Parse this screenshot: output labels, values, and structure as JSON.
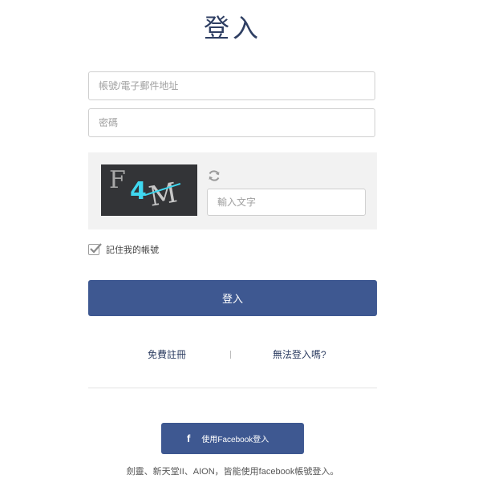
{
  "page": {
    "title": "登入"
  },
  "form": {
    "account_placeholder": "帳號/電子郵件地址",
    "password_placeholder": "密碼",
    "captcha": {
      "chars": [
        "F",
        "4",
        "M"
      ],
      "input_placeholder": "輸入文字",
      "refresh_icon": "refresh-icon"
    },
    "remember_label": "記住我的帳號",
    "remember_checked": true,
    "login_button": "登入"
  },
  "links": {
    "register": "免費註冊",
    "forgot": "無法登入嗎?"
  },
  "facebook": {
    "icon": "f",
    "button_label": "使用Facebook登入"
  },
  "footnote": "劍靈、新天堂II、AION，皆能使用facebook帳號登入。",
  "colors": {
    "primary": "#3e5891",
    "title": "#2f3f63",
    "captcha_bg": "#f2f2f2",
    "captcha_accent": "#3fd8f0"
  }
}
